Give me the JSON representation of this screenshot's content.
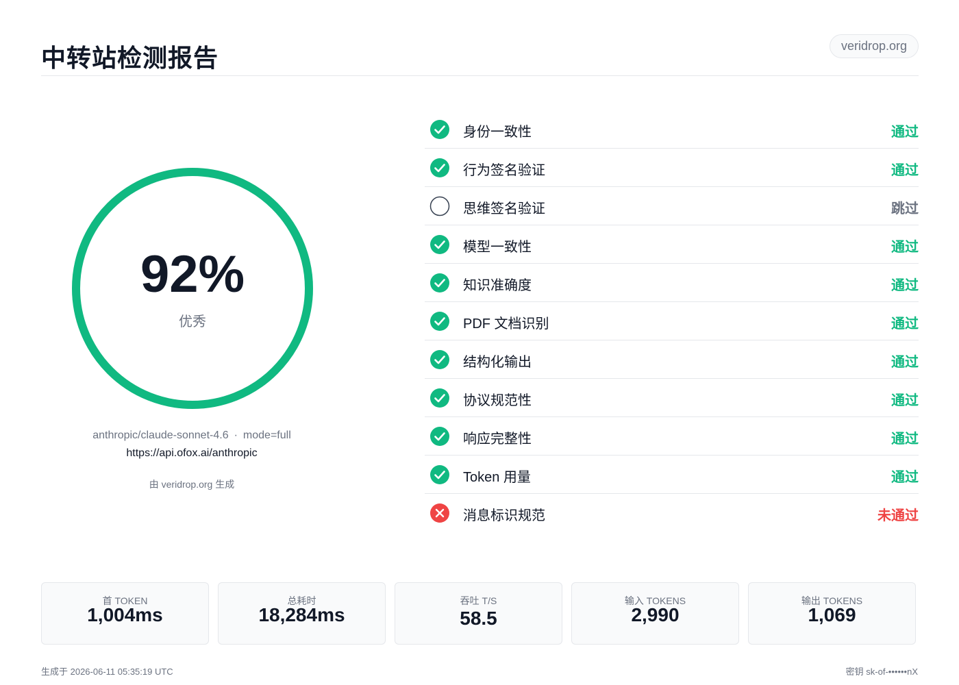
{
  "header": {
    "title": "中转站检测报告",
    "site": "veridrop.org"
  },
  "score": {
    "percent": 92,
    "value_text": "92%",
    "grade": "优秀",
    "ring_color": "#10b981"
  },
  "meta": {
    "model": "anthropic/claude-sonnet-4.6",
    "separator": "·",
    "mode": "mode=full",
    "url": "https://api.ofox.ai/anthropic",
    "generated_by": "由 veridrop.org 生成"
  },
  "colors": {
    "pass": "#10b981",
    "skip": "#6b7280",
    "fail": "#ef4444"
  },
  "checks": [
    {
      "name": "身份一致性",
      "status": "通过",
      "state": "pass",
      "icon": "check-circle-icon"
    },
    {
      "name": "行为签名验证",
      "status": "通过",
      "state": "pass",
      "icon": "check-circle-icon"
    },
    {
      "name": "思维签名验证",
      "status": "跳过",
      "state": "skip",
      "icon": "empty-circle-icon"
    },
    {
      "name": "模型一致性",
      "status": "通过",
      "state": "pass",
      "icon": "check-circle-icon"
    },
    {
      "name": "知识准确度",
      "status": "通过",
      "state": "pass",
      "icon": "check-circle-icon"
    },
    {
      "name": "PDF 文档识别",
      "status": "通过",
      "state": "pass",
      "icon": "check-circle-icon"
    },
    {
      "name": "结构化输出",
      "status": "通过",
      "state": "pass",
      "icon": "check-circle-icon"
    },
    {
      "name": "协议规范性",
      "status": "通过",
      "state": "pass",
      "icon": "check-circle-icon"
    },
    {
      "name": "响应完整性",
      "status": "通过",
      "state": "pass",
      "icon": "check-circle-icon"
    },
    {
      "name": "Token 用量",
      "status": "通过",
      "state": "pass",
      "icon": "check-circle-icon"
    },
    {
      "name": "消息标识规范",
      "status": "未通过",
      "state": "fail",
      "icon": "x-circle-icon"
    }
  ],
  "metrics": [
    {
      "label": "首 TOKEN",
      "value": "1,004ms"
    },
    {
      "label": "总耗时",
      "value": "18,284ms"
    },
    {
      "label": "吞吐 T/S",
      "value": "58.5"
    },
    {
      "label": "输入 TOKENS",
      "value": "2,990"
    },
    {
      "label": "输出 TOKENS",
      "value": "1,069"
    }
  ],
  "footer": {
    "generated_at": "生成于 2026-06-11 05:35:19 UTC",
    "key": "密钥 sk-of-••••••nX"
  }
}
